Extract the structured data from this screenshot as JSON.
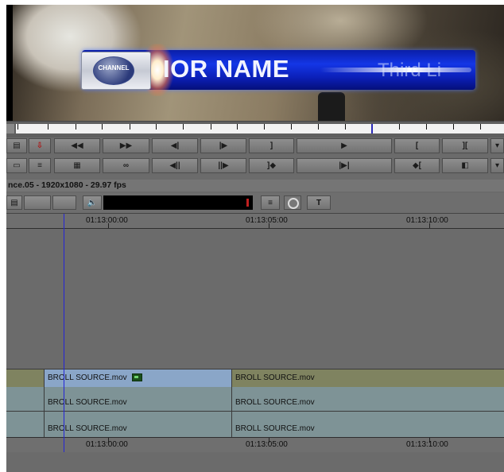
{
  "viewer": {
    "lower_third_name": "IOR NAME",
    "lower_third_sub": "Third Li",
    "logo_text": "CHANNEL"
  },
  "sequence": {
    "info": "nce.05 - 1920x1080 - 29.97 fps"
  },
  "timeline": {
    "timecodes": [
      "01:13:00:00",
      "01:13:05:00",
      "01:13:10:00"
    ],
    "tracks": [
      {
        "clips": [
          {
            "name": "BROLL SOURCE.mov",
            "has_effect": true
          },
          {
            "name": "BROLL SOURCE.mov"
          }
        ]
      },
      {
        "clips": [
          {
            "name": "BROLL SOURCE.mov"
          },
          {
            "name": "BROLL SOURCE.mov"
          }
        ]
      },
      {
        "clips": [
          {
            "name": "BROLL SOURCE.mov"
          },
          {
            "name": "BROLL SOURCE.mov"
          }
        ]
      }
    ]
  },
  "icons": {
    "row1": [
      "track-toggle-icon",
      "lift-red-icon",
      "rewind-icon",
      "fast-forward-icon",
      "step-back-icon",
      "step-forward-icon",
      "mark-out-icon",
      "play-icon",
      "mark-in-icon",
      "clear-marks-icon"
    ],
    "row2": [
      "monitor-icon",
      "settings-sliders-icon",
      "grid-icon",
      "loop-icon",
      "step-back-10-icon",
      "step-forward-10-icon",
      "go-to-out-icon",
      "play-in-to-out-icon",
      "go-to-in-icon",
      "source-record-icon"
    ]
  },
  "colors": {
    "playhead": "#2525d6",
    "clip_selected": "#8aa6c8",
    "clip_video_top": "#7f8360",
    "clip_teal": "#7e9396"
  }
}
